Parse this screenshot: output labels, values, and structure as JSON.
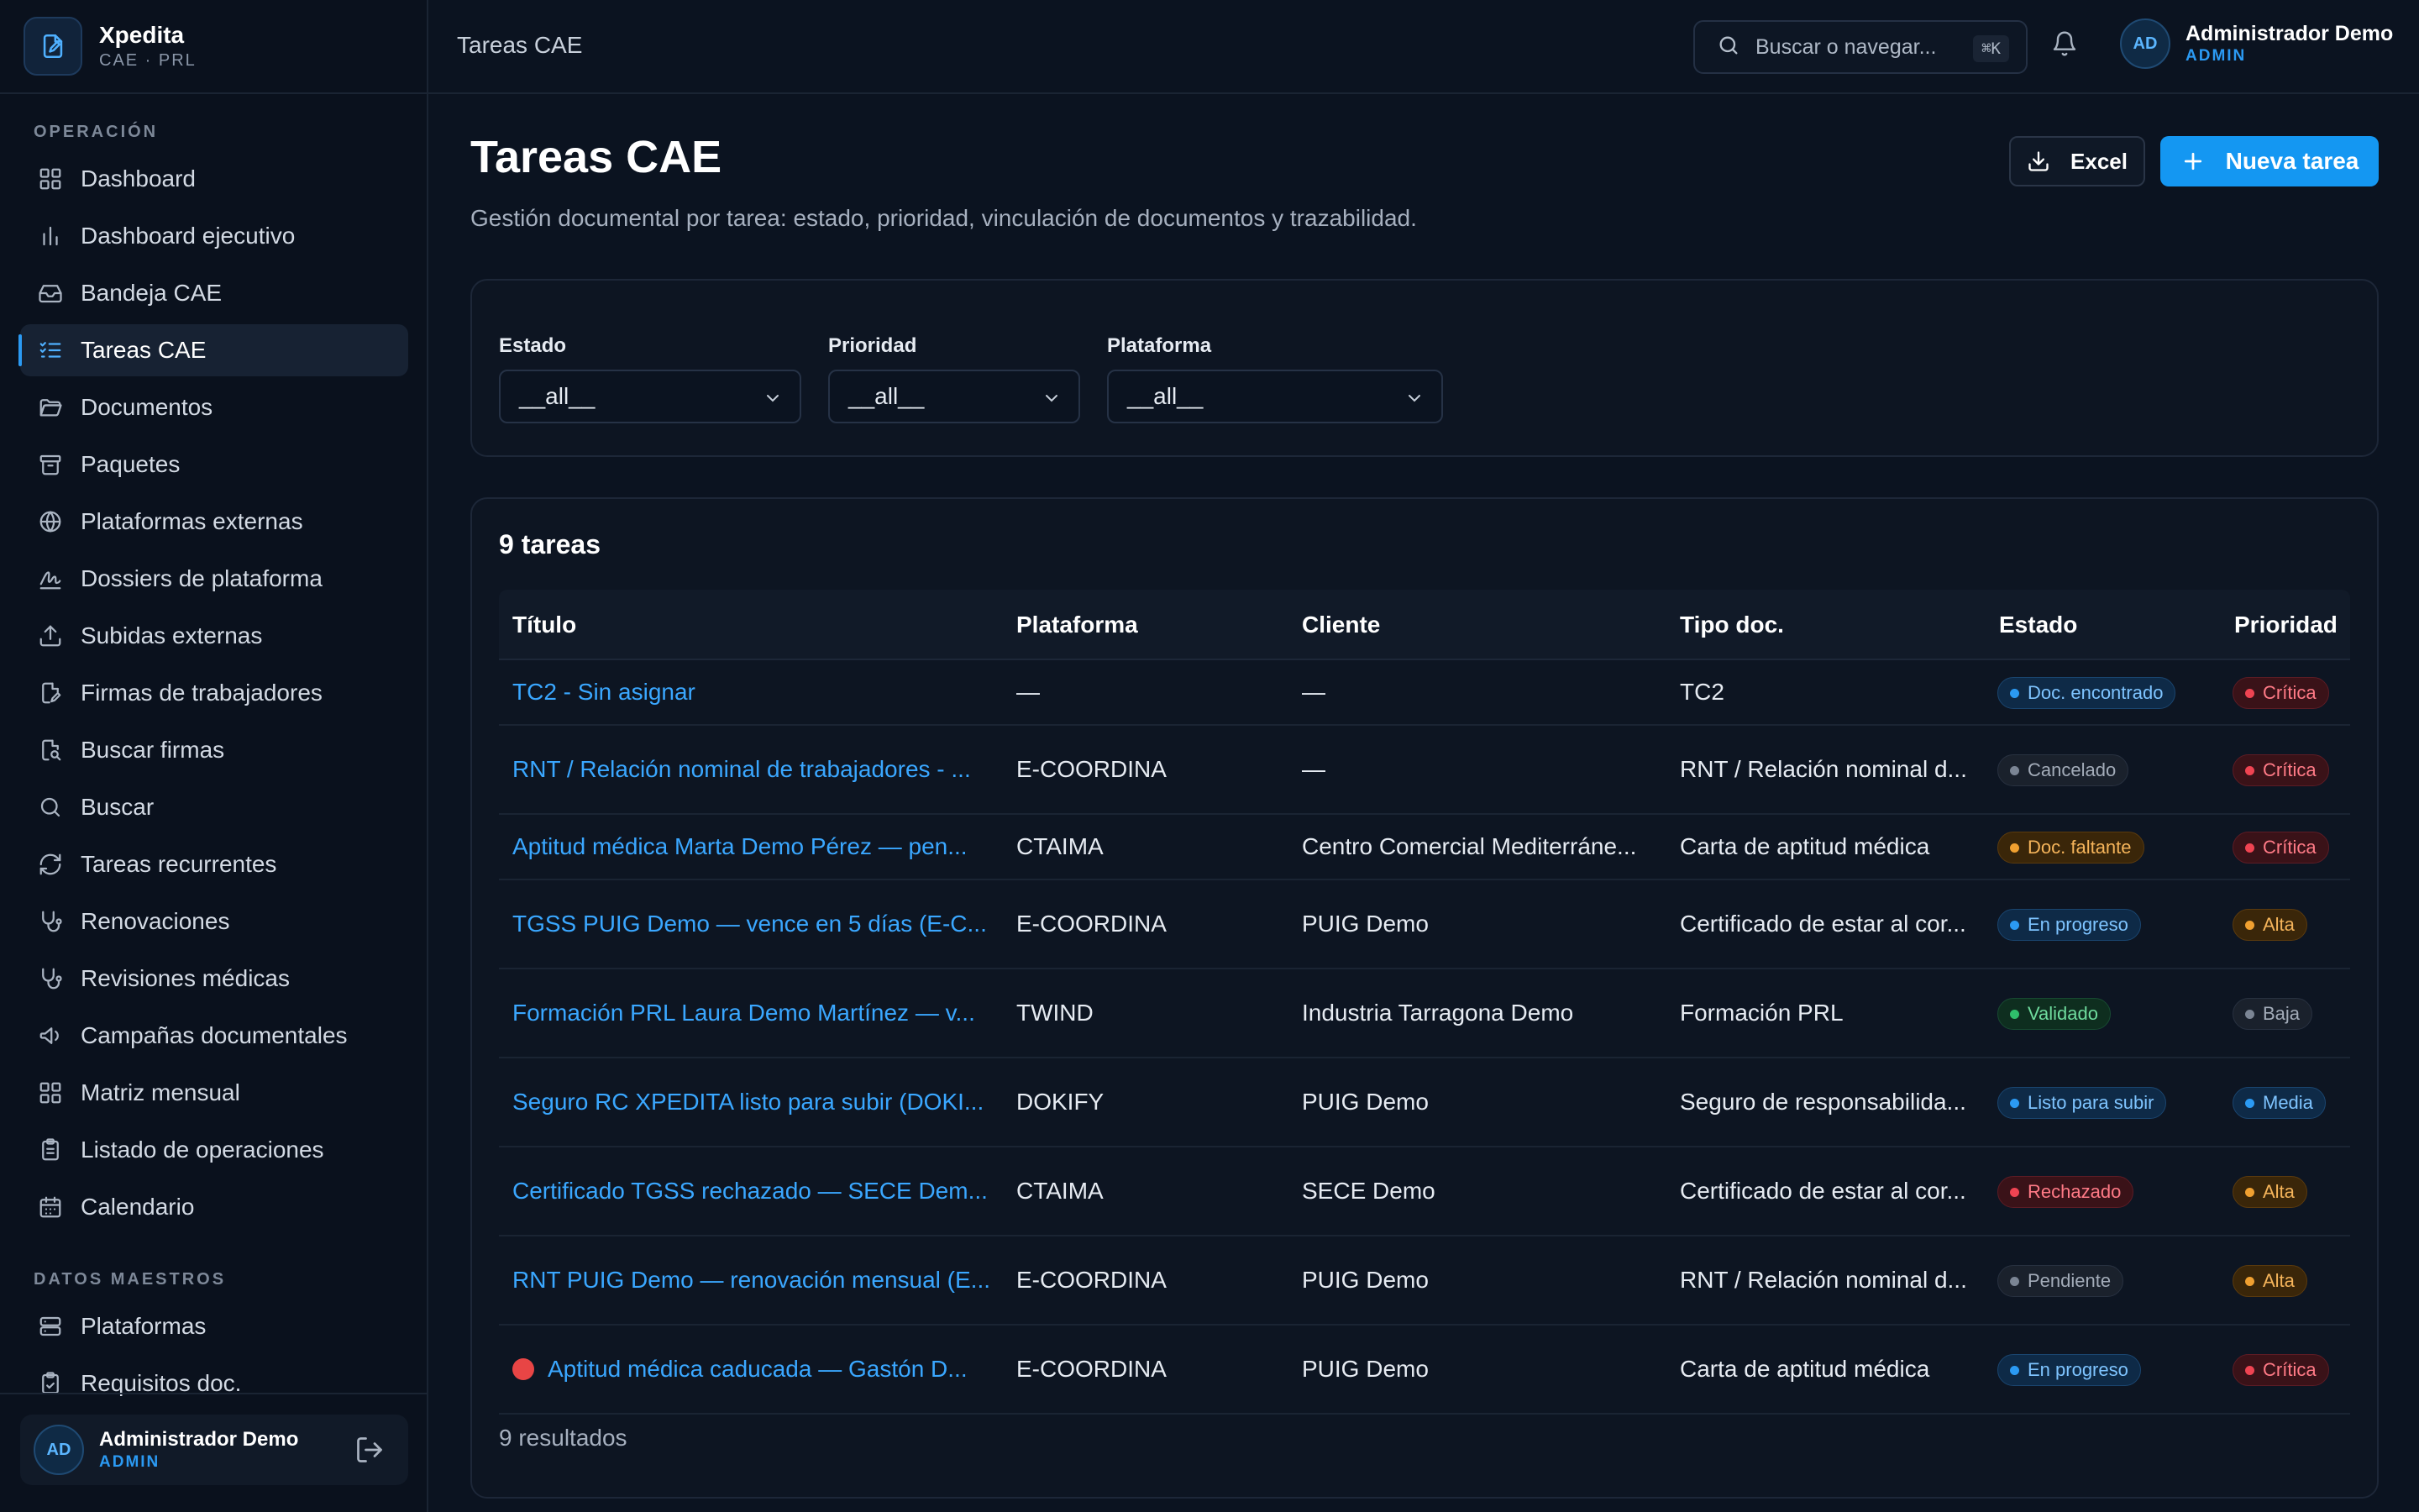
{
  "brand": {
    "name": "Xpedita",
    "subtitle": "CAE · PRL"
  },
  "sidebar": {
    "section_operacion": "OPERACIÓN",
    "items": [
      {
        "label": "Dashboard",
        "icon": "grid-icon"
      },
      {
        "label": "Dashboard ejecutivo",
        "icon": "bar-chart-icon"
      },
      {
        "label": "Bandeja CAE",
        "icon": "inbox-icon"
      },
      {
        "label": "Tareas CAE",
        "icon": "list-check-icon",
        "active": true
      },
      {
        "label": "Documentos",
        "icon": "folder-open-icon"
      },
      {
        "label": "Paquetes",
        "icon": "archive-icon"
      },
      {
        "label": "Plataformas externas",
        "icon": "globe-icon"
      },
      {
        "label": "Dossiers de plataforma",
        "icon": "signature-icon"
      },
      {
        "label": "Subidas externas",
        "icon": "upload-icon"
      },
      {
        "label": "Firmas de trabajadores",
        "icon": "file-pen-icon"
      },
      {
        "label": "Buscar firmas",
        "icon": "file-search-icon"
      },
      {
        "label": "Buscar",
        "icon": "search-icon"
      },
      {
        "label": "Tareas recurrentes",
        "icon": "refresh-icon"
      },
      {
        "label": "Renovaciones",
        "icon": "stethoscope-icon"
      },
      {
        "label": "Revisiones médicas",
        "icon": "stethoscope-icon"
      },
      {
        "label": "Campañas documentales",
        "icon": "megaphone-icon"
      },
      {
        "label": "Matriz mensual",
        "icon": "grid-icon"
      },
      {
        "label": "Listado de operaciones",
        "icon": "clipboard-list-icon"
      },
      {
        "label": "Calendario",
        "icon": "calendar-icon"
      }
    ],
    "section_maestros": "DATOS MAESTROS",
    "master_items": [
      {
        "label": "Plataformas",
        "icon": "server-icon"
      },
      {
        "label": "Requisitos doc.",
        "icon": "clipboard-check-icon"
      }
    ],
    "user": {
      "initials": "AD",
      "name": "Administrador Demo",
      "role": "ADMIN"
    }
  },
  "topbar": {
    "breadcrumb": "Tareas CAE",
    "search_placeholder": "Buscar o navegar...",
    "shortcut": "⌘K",
    "user": {
      "initials": "AD",
      "name": "Administrador Demo",
      "role": "ADMIN"
    }
  },
  "page": {
    "title": "Tareas CAE",
    "description": "Gestión documental por tarea: estado, prioridad, vinculación de documentos y trazabilidad.",
    "excel_label": "Excel",
    "new_label": "Nueva tarea"
  },
  "filters": {
    "estado": {
      "label": "Estado",
      "value": "__all__"
    },
    "prioridad": {
      "label": "Prioridad",
      "value": "__all__"
    },
    "plataforma": {
      "label": "Plataforma",
      "value": "__all__"
    }
  },
  "table": {
    "count_label": "9 tareas",
    "columns": [
      "Título",
      "Plataforma",
      "Cliente",
      "Tipo doc.",
      "Estado",
      "Prioridad"
    ],
    "rows": [
      {
        "titulo": "TC2 - Sin asignar",
        "plataforma": "—",
        "cliente": "—",
        "tipo": "TC2",
        "estado": "Doc. encontrado",
        "estado_color": "blue",
        "prioridad": "Crítica",
        "prioridad_color": "red"
      },
      {
        "titulo": "RNT / Relación nominal de trabajadores - ...",
        "plataforma": "E-COORDINA",
        "cliente": "—",
        "tipo": "RNT / Relación nominal d...",
        "estado": "Cancelado",
        "estado_color": "gray",
        "prioridad": "Crítica",
        "prioridad_color": "red"
      },
      {
        "titulo": "Aptitud médica Marta Demo Pérez — pen...",
        "plataforma": "CTAIMA",
        "cliente": "Centro Comercial Mediterráne...",
        "tipo": "Carta de aptitud médica",
        "estado": "Doc. faltante",
        "estado_color": "orange",
        "prioridad": "Crítica",
        "prioridad_color": "red"
      },
      {
        "titulo": "TGSS PUIG Demo — vence en 5 días (E-C...",
        "plataforma": "E-COORDINA",
        "cliente": "PUIG Demo",
        "tipo": "Certificado de estar al cor...",
        "estado": "En progreso",
        "estado_color": "blue",
        "prioridad": "Alta",
        "prioridad_color": "orange"
      },
      {
        "titulo": "Formación PRL Laura Demo Martínez — v...",
        "plataforma": "TWIND",
        "cliente": "Industria Tarragona Demo",
        "tipo": "Formación PRL",
        "estado": "Validado",
        "estado_color": "green",
        "prioridad": "Baja",
        "prioridad_color": "gray"
      },
      {
        "titulo": "Seguro RC XPEDITA listo para subir (DOKI...",
        "plataforma": "DOKIFY",
        "cliente": "PUIG Demo",
        "tipo": "Seguro de responsabilida...",
        "estado": "Listo para subir",
        "estado_color": "blue",
        "prioridad": "Media",
        "prioridad_color": "blue"
      },
      {
        "titulo": "Certificado TGSS rechazado — SECE Dem...",
        "plataforma": "CTAIMA",
        "cliente": "SECE Demo",
        "tipo": "Certificado de estar al cor...",
        "estado": "Rechazado",
        "estado_color": "red",
        "prioridad": "Alta",
        "prioridad_color": "orange"
      },
      {
        "titulo": "RNT PUIG Demo — renovación mensual (E...",
        "plataforma": "E-COORDINA",
        "cliente": "PUIG Demo",
        "tipo": "RNT / Relación nominal d...",
        "estado": "Pendiente",
        "estado_color": "gray",
        "prioridad": "Alta",
        "prioridad_color": "orange"
      },
      {
        "titulo": "Aptitud médica caducada — Gastón D...",
        "plataforma": "E-COORDINA",
        "cliente": "PUIG Demo",
        "tipo": "Carta de aptitud médica",
        "estado": "En progreso",
        "estado_color": "blue",
        "prioridad": "Crítica",
        "prioridad_color": "red",
        "urgent": true
      }
    ],
    "results_label": "9 resultados"
  }
}
